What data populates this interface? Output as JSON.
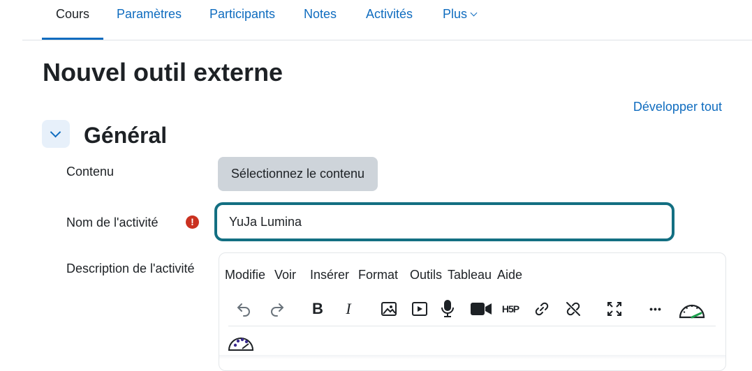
{
  "nav": {
    "tabs": [
      "Cours",
      "Paramètres",
      "Participants",
      "Notes",
      "Activités",
      "Plus"
    ],
    "active": "Cours"
  },
  "page": {
    "title": "Nouvel outil externe",
    "expand_all": "Développer tout"
  },
  "section": {
    "title": "Général",
    "toggle_icon": "chevron-down-icon"
  },
  "fields": {
    "content_label": "Contenu",
    "content_button": "Sélectionnez le contenu",
    "name_label": "Nom de l'activité",
    "name_value": "YuJa Lumina",
    "required_icon": "!",
    "description_label": "Description de l'activité"
  },
  "editor": {
    "menu": [
      "Modifie",
      "Voir",
      "Insérer",
      "Format",
      "Outils",
      "Tableau",
      "Aide"
    ],
    "toolbar_icons": [
      "undo-icon",
      "redo-icon",
      "bold-icon",
      "italic-icon",
      "image-icon",
      "media-icon",
      "microphone-icon",
      "video-camera-icon",
      "h5p-icon",
      "link-icon",
      "unlink-icon",
      "fullscreen-icon",
      "more-icon",
      "accessibility-checker-icon",
      "color-palette-icon"
    ],
    "bold_glyph": "B",
    "italic_glyph": "I",
    "h5p_glyph": "H5P",
    "more_glyph": "•••"
  },
  "colors": {
    "accent": "#0f6cbf",
    "focus_border": "#136f82",
    "required": "#ca3120",
    "button_bg": "#ced4da"
  }
}
